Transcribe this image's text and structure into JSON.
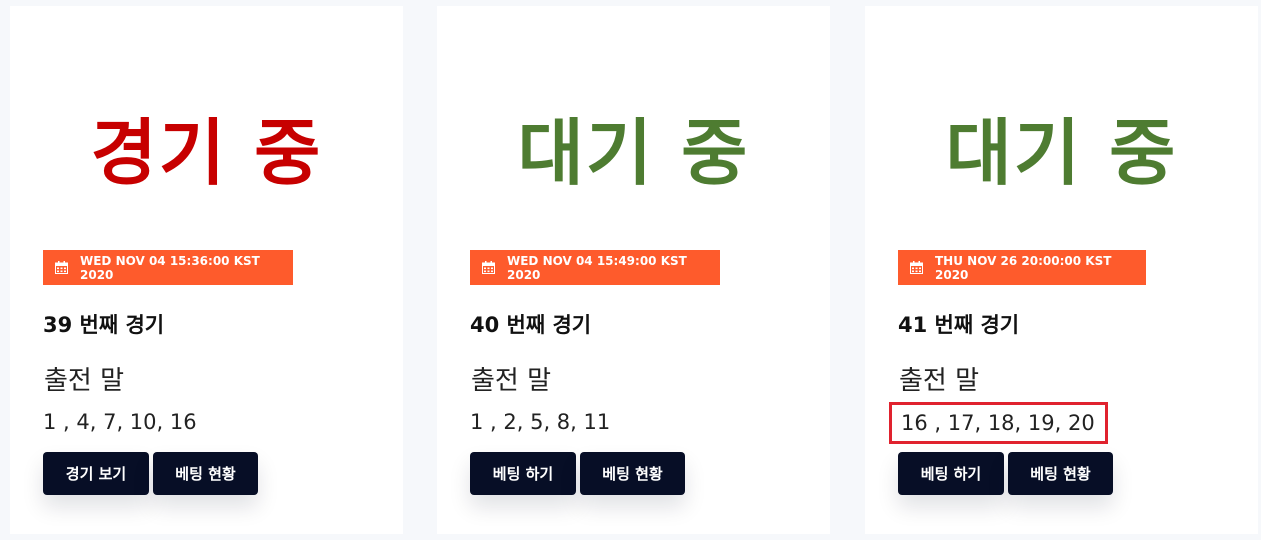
{
  "colors": {
    "badge": "#fe5b2c",
    "button": "#070e26",
    "status_active": "#c70000",
    "status_waiting": "#4e7c31",
    "highlight_border": "#e0222e"
  },
  "cards": [
    {
      "status": "경기 중",
      "status_color": "#c70000",
      "date": "WED NOV 04 15:36:00 KST 2020",
      "game_no": "39 번째 경기",
      "horses_title": "출전 말",
      "horses": "1 , 4, 7, 10, 16",
      "buttons": [
        "경기 보기",
        "베팅 현황"
      ]
    },
    {
      "status": "대기 중",
      "status_color": "#4e7c31",
      "date": "WED NOV 04 15:49:00 KST 2020",
      "game_no": "40 번째 경기",
      "horses_title": "출전 말",
      "horses": "1 , 2, 5, 8, 11",
      "buttons": [
        "베팅 하기",
        "베팅 현황"
      ]
    },
    {
      "status": "대기 중",
      "status_color": "#4e7c31",
      "date": "THU NOV 26 20:00:00 KST 2020",
      "game_no": "41 번째 경기",
      "horses_title": "출전 말",
      "horses": "16 , 17, 18, 19, 20",
      "buttons": [
        "베팅 하기",
        "베팅 현황"
      ]
    }
  ]
}
